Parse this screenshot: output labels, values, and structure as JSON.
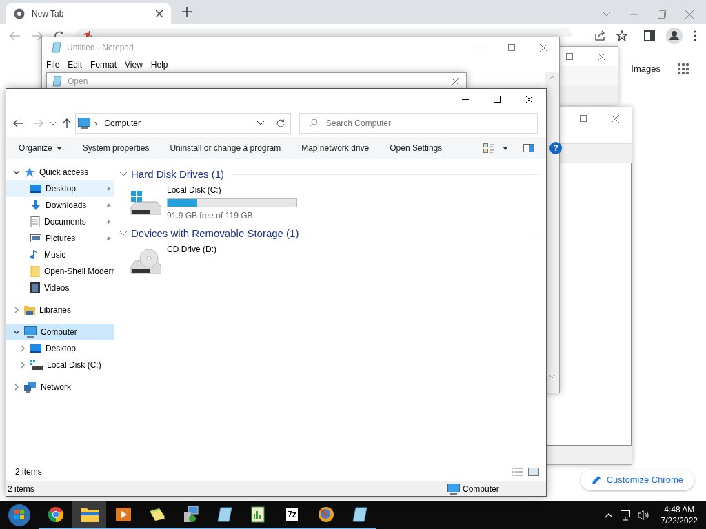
{
  "browser": {
    "tab": {
      "title": "New Tab",
      "selected": true
    },
    "links": [
      "Images"
    ],
    "customize_button": "Customize Chrome"
  },
  "notepad": {
    "title": "Untitled - Notepad",
    "menu": [
      "File",
      "Edit",
      "Format",
      "View",
      "Help"
    ]
  },
  "open_dialog": {
    "title": "Open"
  },
  "explorer": {
    "address": {
      "separator": "›",
      "location": "Computer"
    },
    "search": {
      "placeholder": "Search Computer"
    },
    "commands": [
      {
        "label": "Organize",
        "kind": "menu"
      },
      {
        "label": "System properties",
        "kind": "action"
      },
      {
        "label": "Uninstall or change a program",
        "kind": "action"
      },
      {
        "label": "Map network drive",
        "kind": "action"
      },
      {
        "label": "Open Settings",
        "kind": "action"
      }
    ],
    "help": "?",
    "nav": [
      {
        "label": "Quick access",
        "kind": "star",
        "expanded": true,
        "selected": false,
        "hovered": false,
        "children": [
          {
            "label": "Desktop",
            "kind": "desktop",
            "pinned": true,
            "selected": false,
            "hovered": true
          },
          {
            "label": "Downloads",
            "kind": "download",
            "pinned": true,
            "selected": false,
            "hovered": false
          },
          {
            "label": "Documents",
            "kind": "document",
            "pinned": true,
            "selected": false,
            "hovered": false
          },
          {
            "label": "Pictures",
            "kind": "picture",
            "pinned": true,
            "selected": false,
            "hovered": false
          },
          {
            "label": "Music",
            "kind": "music",
            "pinned": false,
            "selected": false,
            "hovered": false
          },
          {
            "label": "Open-Shell Modern",
            "kind": "folder",
            "pinned": false,
            "selected": false,
            "hovered": false
          },
          {
            "label": "Videos",
            "kind": "video",
            "pinned": false,
            "selected": false,
            "hovered": false
          }
        ]
      },
      {
        "label": "Libraries",
        "kind": "library",
        "expanded": false,
        "selected": false,
        "hovered": false
      },
      {
        "label": "Computer",
        "kind": "computer",
        "expanded": true,
        "selected": true,
        "hovered": false,
        "children": [
          {
            "label": "Desktop",
            "kind": "desktop",
            "expanded": false,
            "selected": false,
            "hovered": false
          },
          {
            "label": "Local Disk (C:)",
            "kind": "disk",
            "expanded": false,
            "selected": false,
            "hovered": false
          }
        ]
      },
      {
        "label": "Network",
        "kind": "network",
        "expanded": false,
        "selected": false,
        "hovered": false
      }
    ],
    "groups": [
      {
        "title": "Hard Disk Drives (1)",
        "items": [
          {
            "name": "Local Disk (C:)",
            "kind": "disk",
            "level": 0.23,
            "free": "91.9 GB free of 119 GB"
          }
        ]
      },
      {
        "title": "Devices with Removable Storage (1)",
        "items": [
          {
            "name": "CD Drive (D:)",
            "kind": "cd"
          }
        ]
      }
    ],
    "pane_status": "2 items",
    "status_bar": {
      "count": "2 items",
      "location": "Computer"
    }
  },
  "taskbar": {
    "items": [
      {
        "kind": "start",
        "active": false,
        "running": false
      },
      {
        "kind": "chrome",
        "active": false,
        "running": true
      },
      {
        "kind": "explorer",
        "active": true,
        "running": true
      },
      {
        "kind": "media",
        "active": false,
        "running": true
      },
      {
        "kind": "files",
        "active": false,
        "running": true
      },
      {
        "kind": "control",
        "active": false,
        "running": true
      },
      {
        "kind": "notepad",
        "active": false,
        "running": true
      },
      {
        "kind": "sheet",
        "active": false,
        "running": true
      },
      {
        "kind": "archive",
        "label": "7z",
        "active": false,
        "running": true
      },
      {
        "kind": "firefox",
        "active": false,
        "running": true
      },
      {
        "kind": "notepad",
        "active": false,
        "running": true
      }
    ],
    "time": "4:48 AM",
    "date": "7/22/2022"
  }
}
